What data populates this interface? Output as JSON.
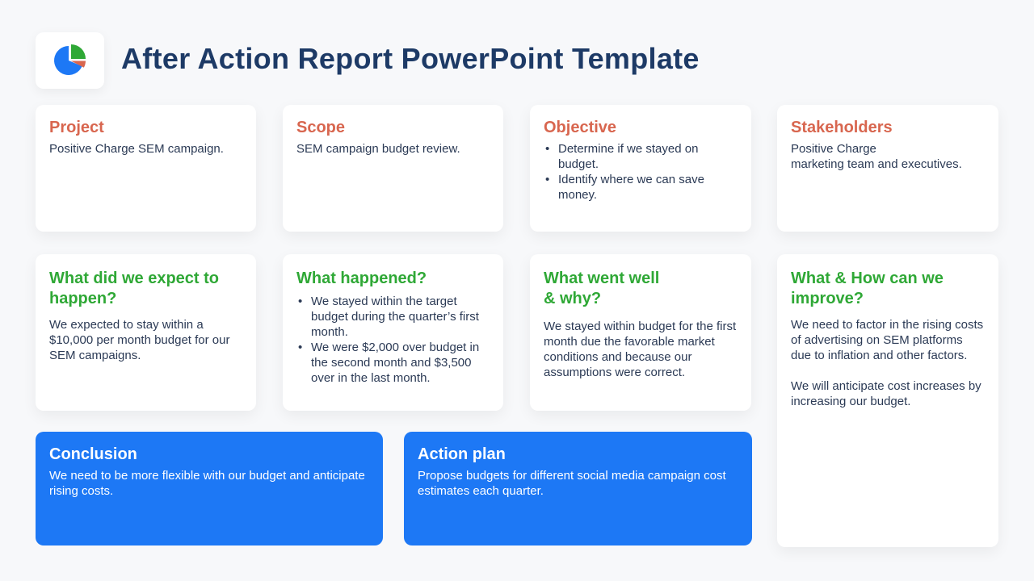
{
  "header": {
    "logo_icon": "pie-chart-icon",
    "title": "After Action Report PowerPoint Template"
  },
  "colors": {
    "title": "#1d3a66",
    "orange_heading": "#d8664f",
    "green_heading": "#2fa836",
    "blue_card": "#1d78f5",
    "pie_blue": "#1d78f5",
    "pie_green": "#2fa836",
    "pie_orange": "#d8664f"
  },
  "cards": {
    "project": {
      "title": "Project",
      "text": "Positive Charge SEM campaign."
    },
    "scope": {
      "title": "Scope",
      "text": "SEM campaign budget review."
    },
    "objective": {
      "title": "Objective",
      "bullets": [
        "Determine if we stayed on budget.",
        "Identify where we can save money."
      ]
    },
    "stakeholders": {
      "title": "Stakeholders",
      "line1": "Positive Charge",
      "line2": "marketing team and executives."
    },
    "expect": {
      "title": "What did we expect to happen?",
      "text": "We expected to stay within a $10,000 per month budget for our SEM campaigns."
    },
    "happened": {
      "title": "What happened?",
      "bullets": [
        "We stayed within the target budget during the quarter’s first month.",
        "We were $2,000 over budget in the second month and $3,500 over in the last month."
      ]
    },
    "went_well": {
      "title_line1": "What went well",
      "title_line2": "& why?",
      "text": "We stayed within budget for the first month due the favorable market conditions and because our assumptions were correct."
    },
    "improve": {
      "title": "What & How can we improve?",
      "paragraph1": "We need to factor in the rising costs of advertising on SEM platforms due to inflation and other factors.",
      "paragraph2": "We will anticipate cost increases by increasing our budget."
    },
    "conclusion": {
      "title": "Conclusion",
      "text": "We need to be more flexible with our budget and anticipate rising costs."
    },
    "action_plan": {
      "title": "Action plan",
      "text": "Propose budgets for different social media campaign cost estimates each quarter."
    }
  }
}
